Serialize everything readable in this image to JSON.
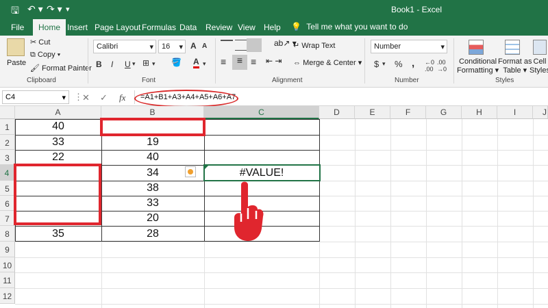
{
  "window": {
    "title": "Book1  -  Excel"
  },
  "tabs": [
    "File",
    "Home",
    "Insert",
    "Page Layout",
    "Formulas",
    "Data",
    "Review",
    "View",
    "Help"
  ],
  "tell_me": "Tell me what you want to do",
  "ribbon": {
    "clipboard": {
      "paste": "Paste",
      "cut": "Cut",
      "copy": "Copy",
      "format_painter": "Format Painter",
      "label": "Clipboard"
    },
    "font": {
      "name": "Calibri",
      "size": "16",
      "label": "Font",
      "bold": "B",
      "italic": "I",
      "underline": "U",
      "font_color": "A",
      "grow": "A",
      "shrink": "A"
    },
    "alignment": {
      "wrap": "Wrap Text",
      "merge": "Merge & Center",
      "label": "Alignment"
    },
    "number": {
      "format": "Number",
      "label": "Number",
      "currency": "$",
      "percent": "%",
      "comma": ","
    },
    "styles": {
      "conditional": [
        "Conditional",
        "Formatting"
      ],
      "table": [
        "Format as",
        "Table"
      ],
      "cell": [
        "Cell",
        "Styles"
      ],
      "label": "Styles"
    }
  },
  "formula_bar": {
    "name_box": "C4",
    "fx": "fx",
    "formula": "=A1+B1+A3+A4+A5+A6+A7"
  },
  "columns": [
    "A",
    "B",
    "C",
    "D",
    "E",
    "F",
    "G",
    "H",
    "I",
    "J"
  ],
  "rows": [
    "1",
    "2",
    "3",
    "4",
    "5",
    "6",
    "7",
    "8",
    "9",
    "10",
    "11",
    "12"
  ],
  "cells": {
    "A1": "40",
    "A2": "33",
    "A3": "22",
    "A8": "35",
    "B2": "19",
    "B3": "40",
    "B4": "34",
    "B5": "38",
    "B6": "33",
    "B7": "20",
    "B8": "28",
    "C4": "#VALUE!"
  },
  "colors": {
    "excel_green": "#217346",
    "highlight_red": "#e0262e"
  },
  "icons": [
    "save-icon",
    "undo-icon",
    "redo-icon",
    "error-warning-icon",
    "pointing-hand-icon"
  ]
}
